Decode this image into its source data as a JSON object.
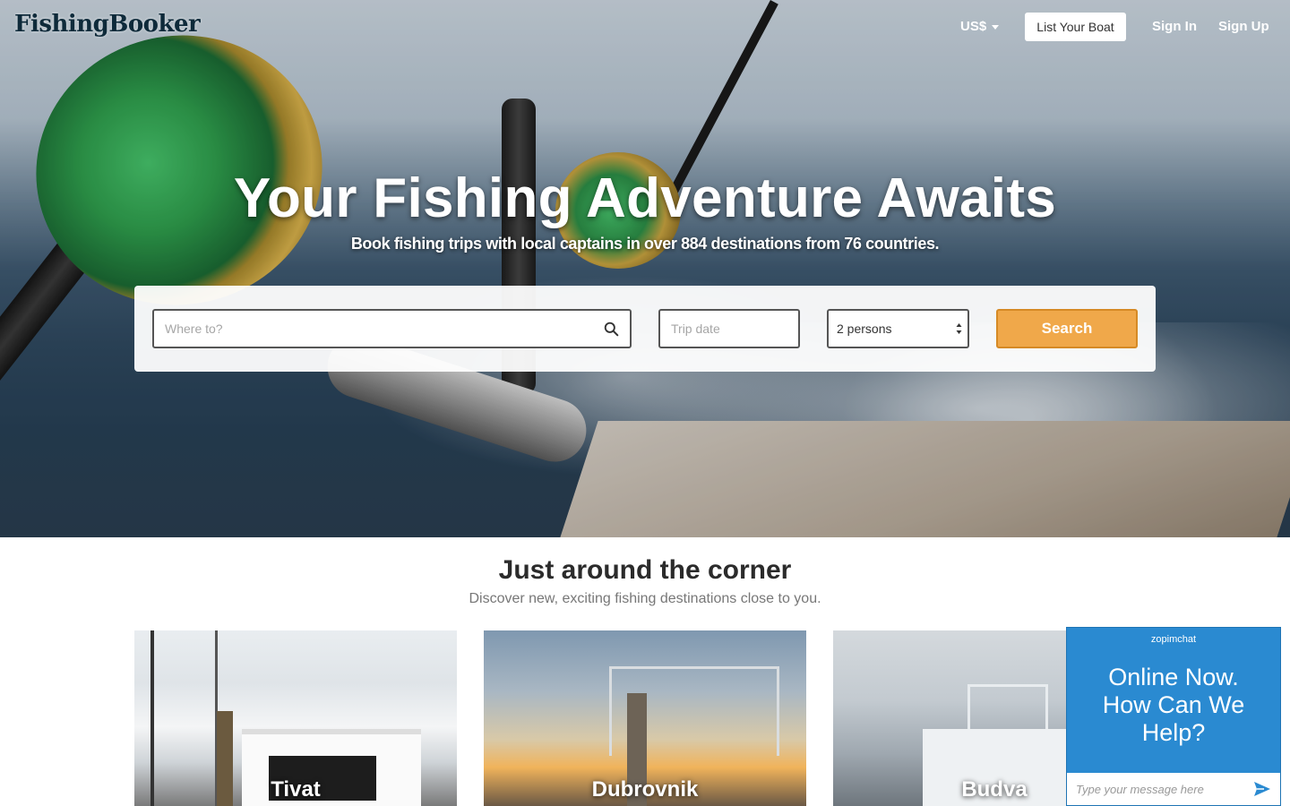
{
  "nav": {
    "logo": "FishingBooker",
    "currency": "US$",
    "list_boat": "List Your Boat",
    "sign_in": "Sign In",
    "sign_up": "Sign Up"
  },
  "hero": {
    "title": "Your Fishing Adventure Awaits",
    "subtitle": "Book fishing trips with local captains in over 884 destinations from 76 countries."
  },
  "search": {
    "where_placeholder": "Where to?",
    "date_placeholder": "Trip date",
    "persons_value": "2 persons",
    "button": "Search"
  },
  "section": {
    "title": "Just around the corner",
    "subtitle": "Discover new, exciting fishing destinations close to you."
  },
  "destinations": [
    {
      "name": "Tivat"
    },
    {
      "name": "Dubrovnik"
    },
    {
      "name": "Budva"
    }
  ],
  "chat": {
    "brand": "zopimchat",
    "message": "Online Now. How Can We Help?",
    "input_placeholder": "Type your message here"
  },
  "colors": {
    "search_button": "#f0a84a",
    "chat_background": "#2a8ad1"
  },
  "icons": {
    "search": "search-icon",
    "send": "send-icon",
    "caret": "caret-down-icon",
    "select": "select-arrows-icon"
  }
}
